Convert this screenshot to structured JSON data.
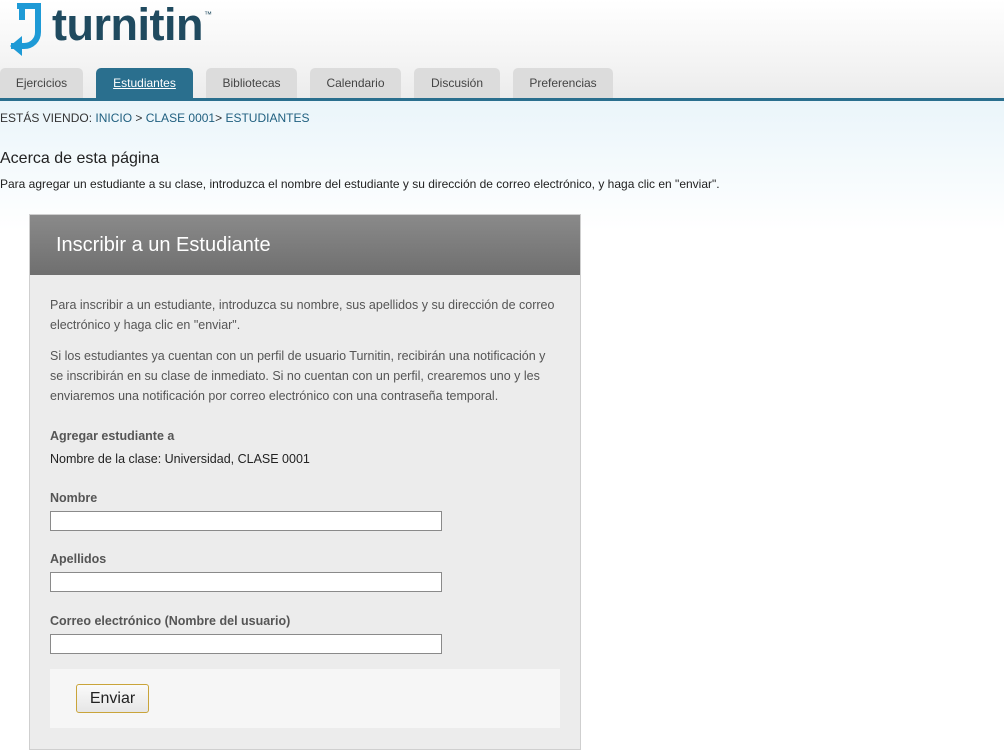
{
  "brand": {
    "name": "turnitin",
    "tm": "™"
  },
  "tabs": [
    {
      "label": "Ejercicios",
      "active": false
    },
    {
      "label": "Estudiantes",
      "active": true
    },
    {
      "label": "Bibliotecas",
      "active": false
    },
    {
      "label": "Calendario",
      "active": false
    },
    {
      "label": "Discusión",
      "active": false
    },
    {
      "label": "Preferencias",
      "active": false
    }
  ],
  "breadcrumb": {
    "prefix": "ESTÁS VIENDO: ",
    "home": "INICIO",
    "sep1": " > ",
    "class": "CLASE 0001",
    "sep2": "> ",
    "current": "ESTUDIANTES"
  },
  "about": {
    "title": "Acerca de esta página",
    "text": "Para agregar un estudiante a su clase, introduzca el nombre del estudiante y su dirección de correo electrónico, y haga clic en \"enviar\"."
  },
  "panel": {
    "title": "Inscribir a un Estudiante",
    "intro1": "Para inscribir a un estudiante, introduzca su nombre, sus apellidos y su dirección de correo electrónico y haga clic en \"enviar\".",
    "intro2": "Si los estudiantes ya cuentan con un perfil de usuario Turnitin, recibirán una notificación y se inscribirán en su clase de inmediato. Si no cuentan con un perfil, crearemos uno y les enviaremos una notificación por correo electrónico con una contraseña temporal.",
    "add_to_label": "Agregar estudiante a",
    "class_name": "Nombre de la clase: Universidad, CLASE 0001",
    "fields": {
      "first_name": {
        "label": "Nombre",
        "value": ""
      },
      "last_name": {
        "label": "Apellidos",
        "value": ""
      },
      "email": {
        "label": "Correo electrónico (Nombre del usuario)",
        "value": ""
      }
    },
    "submit_label": "Enviar"
  },
  "colors": {
    "brand": "#1f4a5f",
    "accent": "#2a6f8e",
    "logo_icon": "#1e9ad6"
  }
}
